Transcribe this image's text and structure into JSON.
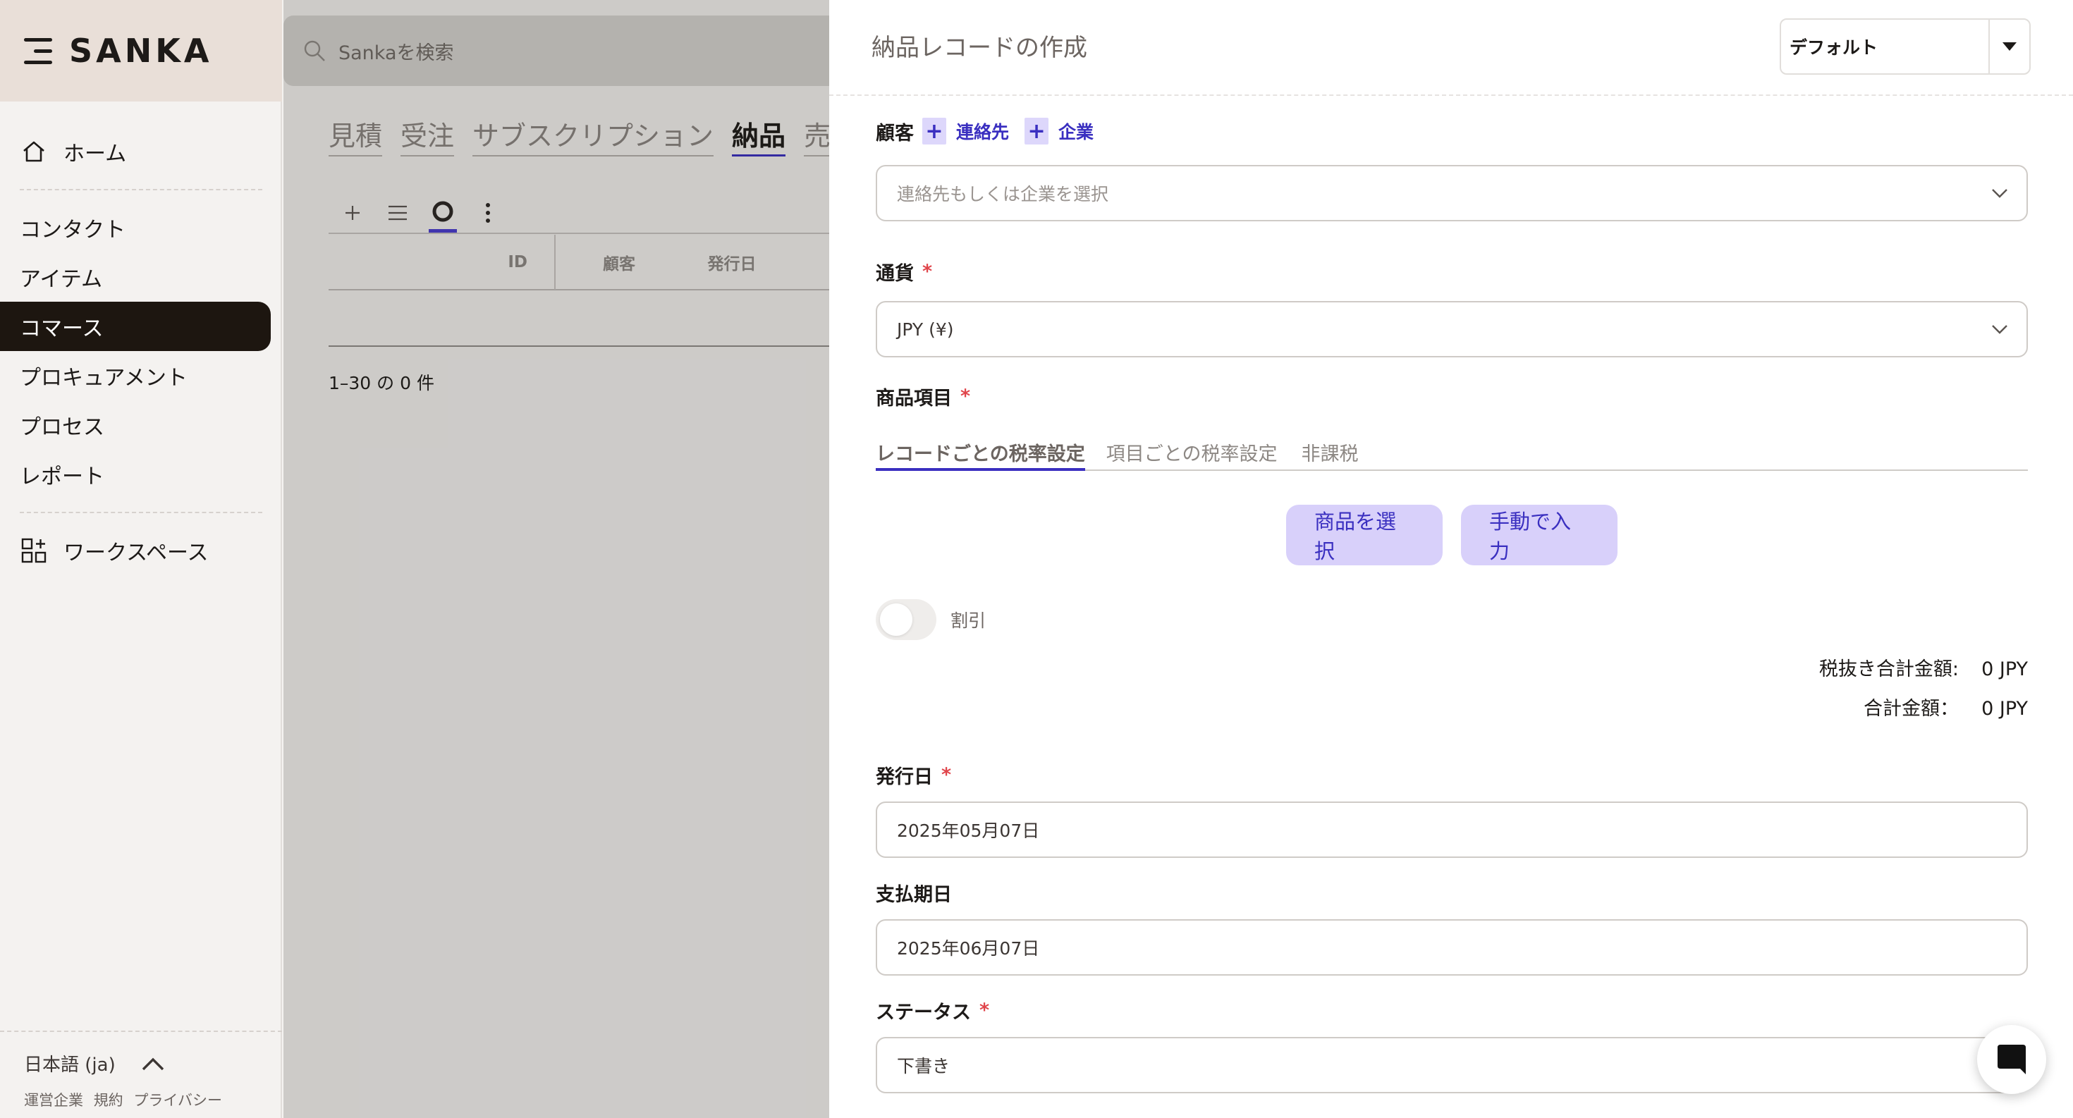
{
  "brand": {
    "name": "SANKA"
  },
  "search": {
    "placeholder": "Sankaを検索"
  },
  "sidebar": {
    "home": "ホーム",
    "items": [
      "コンタクト",
      "アイテム",
      "コマース",
      "プロキュアメント",
      "プロセス",
      "レポート"
    ],
    "workspace": "ワークスペース",
    "language": "日本語 (ja)",
    "legal": [
      "運営企業",
      "規約",
      "プライバシー"
    ]
  },
  "main": {
    "tabs": [
      "見積",
      "受注",
      "サブスクリプション",
      "納品",
      "売上"
    ],
    "current_tab": "納品",
    "columns": [
      "ID",
      "顧客",
      "発行日"
    ],
    "pager": "1–30 の 0 件"
  },
  "drawer": {
    "title": "納品レコードの作成",
    "view_select": "デフォルト",
    "customer": {
      "label": "顧客",
      "add_contact": "連絡先",
      "add_company": "企業",
      "placeholder": "連絡先もしくは企業を選択"
    },
    "currency": {
      "label": "通貨",
      "value": "JPY (¥)"
    },
    "items": {
      "label": "商品項目",
      "tax_tabs": [
        "レコードごとの税率設定",
        "項目ごとの税率設定",
        "非課税"
      ],
      "select_button": "商品を選択",
      "manual_button": "手動で入力"
    },
    "discount": {
      "label": "割引",
      "enabled": false
    },
    "totals": {
      "subtotal_label": "税抜き合計金額:",
      "subtotal_value": "0 JPY",
      "total_label": "合計金額：",
      "total_value": "0 JPY"
    },
    "issue_date": {
      "label": "発行日",
      "value": "2025年05月07日"
    },
    "due_date": {
      "label": "支払期日",
      "value": "2025年06月07日"
    },
    "status": {
      "label": "ステータス",
      "value": "下書き"
    },
    "required_mark": "*"
  },
  "colors": {
    "accent": "#3a2fc0",
    "active_nav": "#1d1610",
    "button_bg": "#d8d0fa",
    "required": "#e0454b"
  }
}
